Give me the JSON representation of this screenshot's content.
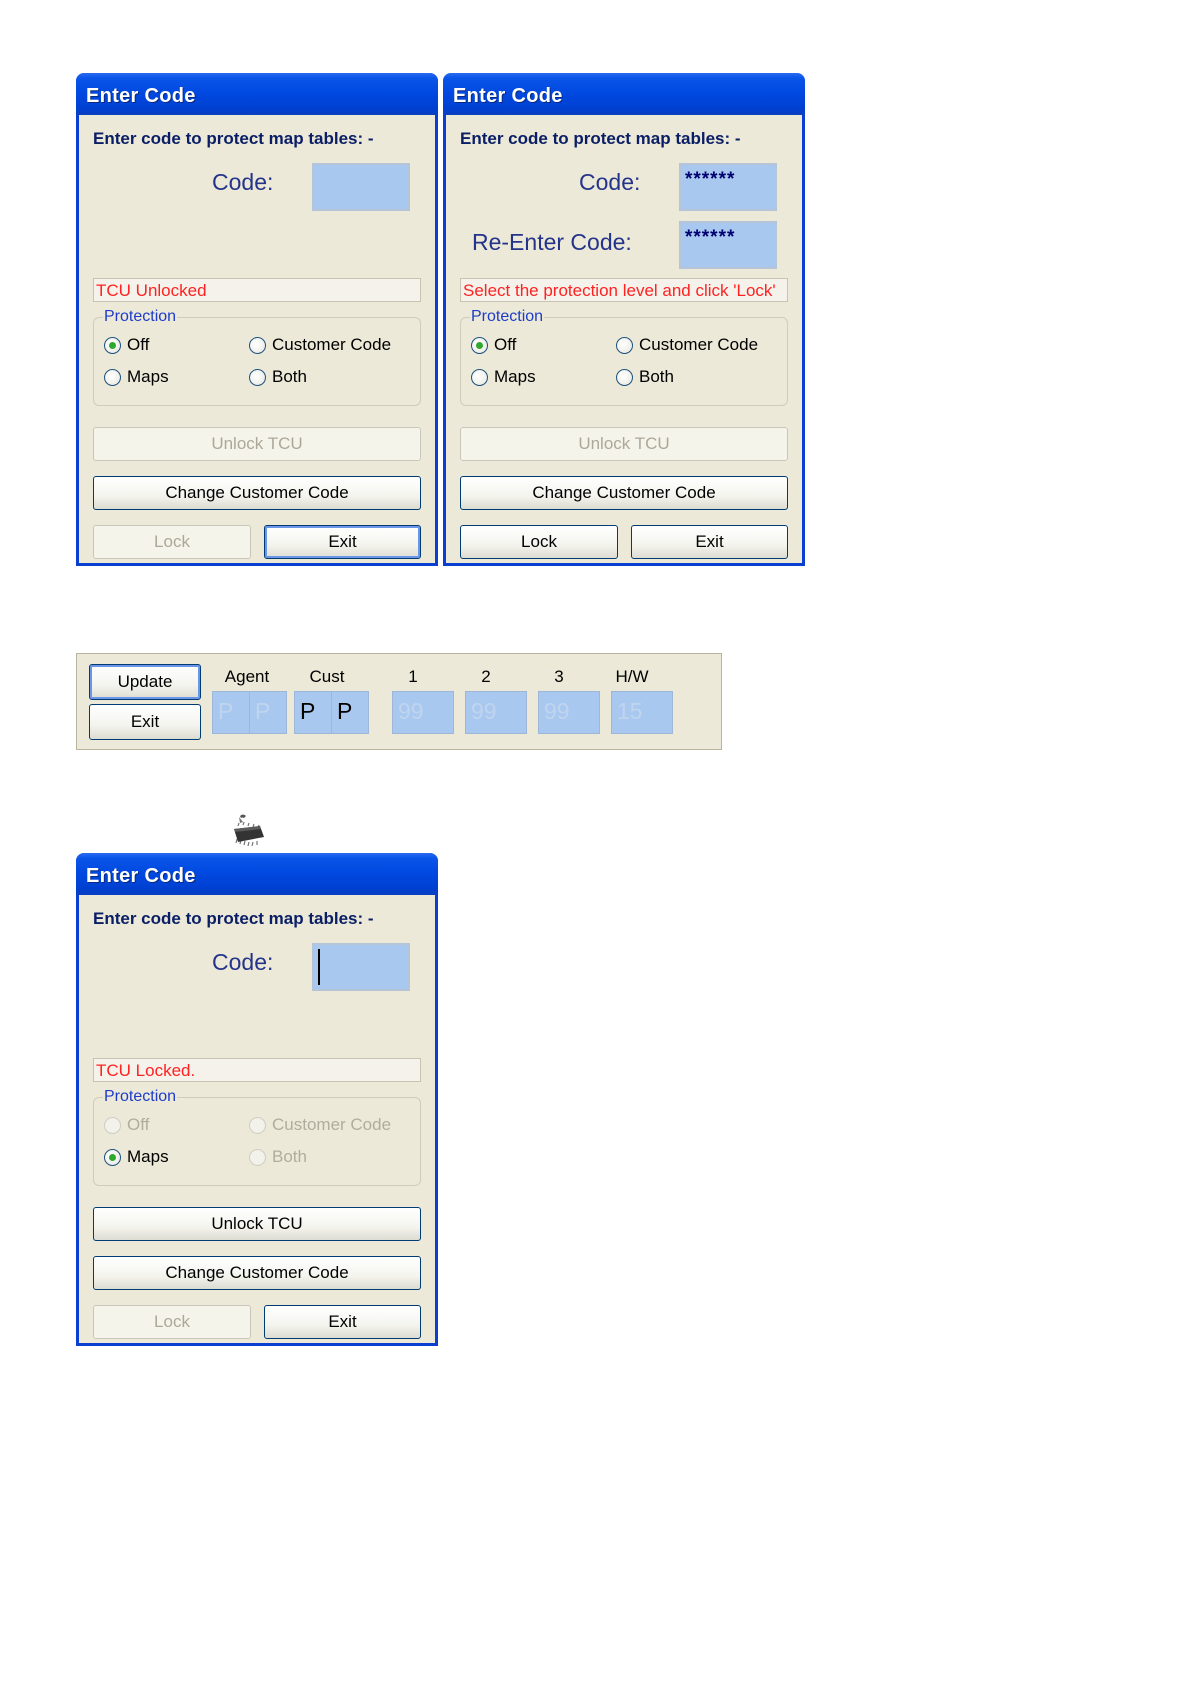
{
  "dialogs": [
    {
      "title": "Enter Code",
      "heading": "Enter code to protect map tables: -",
      "code_label": "Code:",
      "code_value": "",
      "status": "TCU Unlocked",
      "protection_label": "Protection",
      "options": [
        "Off",
        "Customer Code",
        "Maps",
        "Both"
      ],
      "selected": "Off",
      "unlock_label": "Unlock TCU",
      "change_label": "Change Customer Code",
      "lock_label": "Lock",
      "exit_label": "Exit"
    },
    {
      "title": "Enter Code",
      "heading": "Enter code to protect map tables: -",
      "code_label": "Code:",
      "code_value": "******",
      "reenter_label": "Re-Enter Code:",
      "reenter_value": "******",
      "status": "Select the protection level and click 'Lock'",
      "protection_label": "Protection",
      "options": [
        "Off",
        "Customer Code",
        "Maps",
        "Both"
      ],
      "selected": "Off",
      "unlock_label": "Unlock TCU",
      "change_label": "Change Customer Code",
      "lock_label": "Lock",
      "exit_label": "Exit"
    },
    {
      "title": "Enter Code",
      "heading": "Enter code to protect map tables: -",
      "code_label": "Code:",
      "code_value": "",
      "status": "TCU Locked.",
      "protection_label": "Protection",
      "options": [
        "Off",
        "Customer Code",
        "Maps",
        "Both"
      ],
      "selected": "Maps",
      "unlock_label": "Unlock TCU",
      "change_label": "Change Customer Code",
      "lock_label": "Lock",
      "exit_label": "Exit"
    }
  ],
  "toolbar": {
    "update_label": "Update",
    "exit_label": "Exit",
    "columns": [
      "Agent",
      "Cust",
      "1",
      "2",
      "3",
      "H/W"
    ],
    "agent_values": [
      "P",
      "P"
    ],
    "cust_values": [
      "P",
      "P"
    ],
    "v1": "99",
    "v2": "99",
    "v3": "99",
    "hw": "15"
  },
  "icons": [
    "chip-icon"
  ],
  "colors": {
    "title_bar": "#0048e0",
    "input_bg": "#a8c8f0",
    "status_text": "#ff2222",
    "group_label": "#1e3cc8"
  }
}
